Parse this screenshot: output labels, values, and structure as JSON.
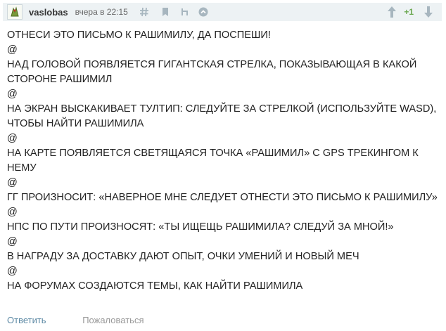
{
  "comment": {
    "author": "vaslobas",
    "timestamp": "вчера в 22:15",
    "score": "+1",
    "lines": [
      "ОТНЕСИ ЭТО ПИСЬМО К РАШИМИЛУ, ДА ПОСПЕШИ!",
      "@",
      "НАД ГОЛОВОЙ ПОЯВЛЯЕТСЯ ГИГАНТСКАЯ СТРЕЛКА, ПОКАЗЫВАЮЩАЯ В КАКОЙ СТОРОНЕ РАШИМИЛ",
      "@",
      "НА ЭКРАН ВЫСКАКИВАЕТ ТУЛТИП: СЛЕДУЙТЕ ЗА СТРЕЛКОЙ (ИСПОЛЬЗУЙТЕ WASD), ЧТОБЫ НАЙТИ РАШИМИЛА",
      "@",
      "НА КАРТЕ ПОЯВЛЯЕТСЯ СВЕТЯЩАЯСЯ ТОЧКА «РАШИМИЛ» С GPS ТРЕКИНГОМ К НЕМУ",
      "@",
      "ГГ ПРОИЗНОСИТ: «НАВЕРНОЕ МНЕ СЛЕДУЕТ ОТНЕСТИ ЭТО ПИСЬМО К РАШИМИЛУ»",
      "@",
      "НПС ПО ПУТИ ПРОИЗНОСЯТ: «ТЫ ИЩЕЩЬ РАШИМИЛА? СЛЕДУЙ ЗА МНОЙ!»",
      "@",
      "В НАГРАДУ ЗА ДОСТАВКУ ДАЮТ ОПЫТ, ОЧКИ УМЕНИЙ И НОВЫЙ МЕЧ",
      "@",
      "НА ФОРУМАХ СОЗДАЮТСЯ ТЕМЫ, КАК НАЙТИ РАШИМИЛА"
    ]
  },
  "actions": {
    "reply": "Ответить",
    "report": "Пожаловаться"
  },
  "icons": {
    "avatar": "avatar-icon",
    "permalink": "hash-icon",
    "bookmark": "bookmark-icon",
    "parent": "parent-link-icon",
    "scroll_up": "circle-up-icon",
    "vote_up": "arrow-up-icon",
    "vote_down": "arrow-down-icon"
  },
  "colors": {
    "header_bg": "#edf2f4",
    "score": "#6aa84f",
    "reply_link": "#5e8aa5",
    "muted": "#999999"
  }
}
